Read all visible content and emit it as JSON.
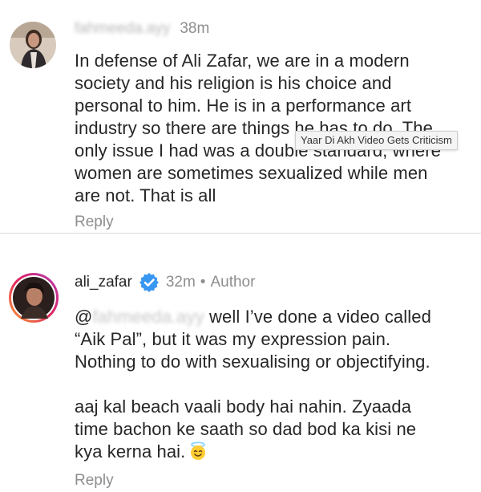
{
  "comments": [
    {
      "username": "fahmeeda.ayy",
      "time": "38m",
      "text": "In defense of Ali Zafar, we are in a modern\nsociety and his religion is his choice and\npersonal to him. He is in a performance art\nindustry so there are things he has to do. The\nonly issue I had was a double standard, where\nwomen are sometimes sexualized while men\nare not. That is all",
      "reply_label": "Reply"
    },
    {
      "username": "ali_zafar",
      "verified_icon": "verified-badge-icon",
      "time": "32m",
      "separator": "•",
      "role": "Author",
      "mention_prefix": "@",
      "mention_handle": "fahmeeda.ayy",
      "line1_rest": " well I’ve done a video called",
      "text_part1": "“Aik Pal”, but it was my expression pain.\nNothing to do with sexualising or objectifying.",
      "text_part2": "aaj kal beach vaali body hai nahin. Zyaada\ntime bachon ke saath so dad bod ka kisi ne\nkya kerna hai.",
      "emoji": "smiling-face-with-halo",
      "reply_label": "Reply"
    }
  ],
  "tooltip": "Yaar Di Akh Video Gets Criticism",
  "colors": {
    "text": "#262626",
    "meta": "#8e8e8e",
    "divider": "#dbdbdb",
    "verified": "#3897f0"
  }
}
